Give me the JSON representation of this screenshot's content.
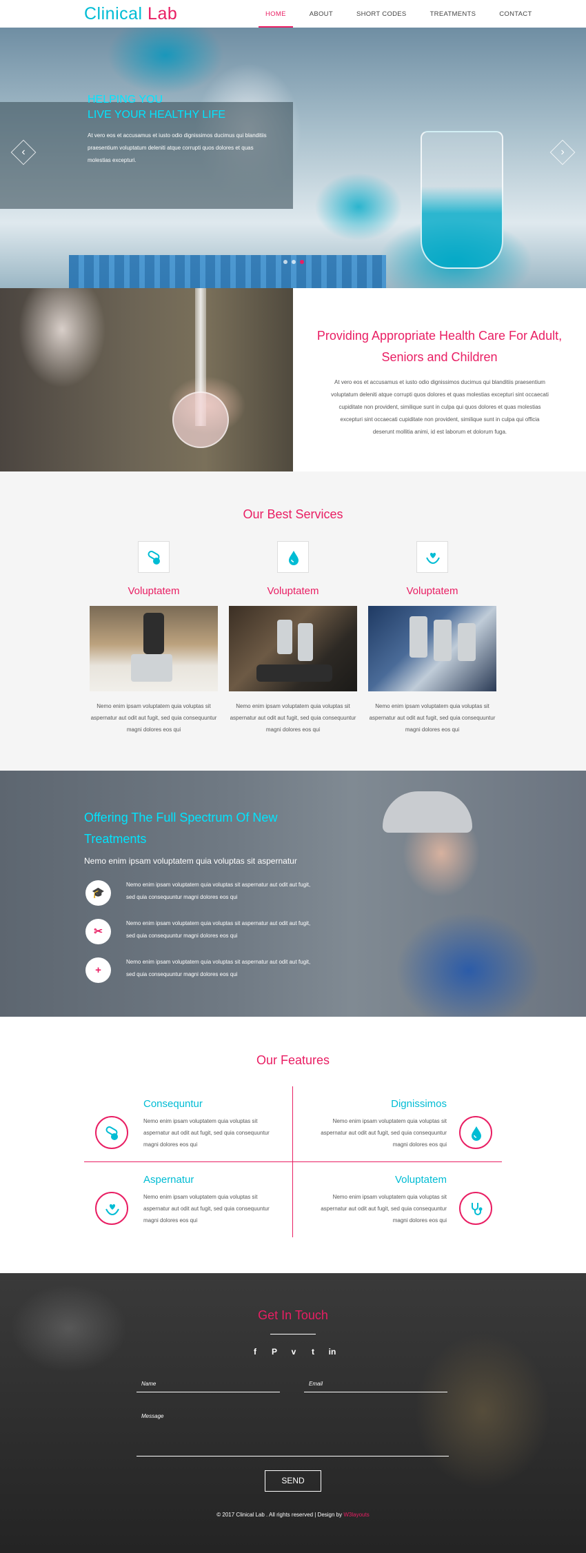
{
  "nav": {
    "logo_main": "Clinical",
    "logo_accent": "Lab",
    "items": [
      {
        "label": "HOME",
        "active": true
      },
      {
        "label": "ABOUT",
        "active": false
      },
      {
        "label": "SHORT CODES",
        "active": false
      },
      {
        "label": "TREATMENTS",
        "active": false
      },
      {
        "label": "CONTACT",
        "active": false
      }
    ]
  },
  "hero": {
    "title_line1": "HELPING YOU",
    "title_line2": "LIVE YOUR HEALTHY LIFE",
    "text": "At vero eos et accusamus et iusto odio dignissimos ducimus qui blanditiis praesentium voluptatum deleniti atque corrupti quos dolores et quas molestias excepturi.",
    "slides": 3,
    "active_slide": 3
  },
  "about": {
    "title": "Providing Appropriate Health Care For Adult, Seniors and Children",
    "text": "At vero eos et accusamus et iusto odio dignissimos ducimus qui blanditiis praesentium voluptatum deleniti atque corrupti quos dolores et quas molestias excepturi sint occaecati cupiditate non provident, similique sunt in culpa qui quos dolores et quas molestias excepturi sint occaecati cupiditate non provident, similique sunt in culpa qui officia deserunt mollitia animi, id est laborum et dolorum fuga."
  },
  "services": {
    "title": "Our Best Services",
    "items": [
      {
        "title": "Voluptatem",
        "icon": "pills-icon",
        "text": "Nemo enim ipsam voluptatem quia voluptas sit aspernatur aut odit aut fugit, sed quia consequuntur magni dolores eos qui"
      },
      {
        "title": "Voluptatem",
        "icon": "drops-icon",
        "text": "Nemo enim ipsam voluptatem quia voluptas sit aspernatur aut odit aut fugit, sed quia consequuntur magni dolores eos qui"
      },
      {
        "title": "Voluptatem",
        "icon": "heart-hands-icon",
        "text": "Nemo enim ipsam voluptatem quia voluptas sit aspernatur aut odit aut fugit, sed quia consequuntur magni dolores eos qui"
      }
    ]
  },
  "treatments": {
    "title": "Offering The Full Spectrum Of New Treatments",
    "subtitle": "Nemo enim ipsam voluptatem quia voluptas sit aspernatur",
    "items": [
      {
        "icon": "graduation-cap-icon",
        "text": "Nemo enim ipsam voluptatem quia voluptas sit aspernatur aut odit aut fugit, sed quia consequuntur magni dolores eos qui"
      },
      {
        "icon": "scissors-icon",
        "text": "Nemo enim ipsam voluptatem quia voluptas sit aspernatur aut odit aut fugit, sed quia consequuntur magni dolores eos qui"
      },
      {
        "icon": "plus-icon",
        "text": "Nemo enim ipsam voluptatem quia voluptas sit aspernatur aut odit aut fugit, sed quia consequuntur magni dolores eos qui"
      }
    ]
  },
  "features": {
    "title": "Our Features",
    "items": [
      {
        "title": "Consequntur",
        "icon": "pills-icon",
        "text": "Nemo enim ipsam voluptatem quia voluptas sit aspernatur aut odit aut fugit, sed quia consequuntur magni dolores eos qui"
      },
      {
        "title": "Dignissimos",
        "icon": "drops-icon",
        "text": "Nemo enim ipsam voluptatem quia voluptas sit aspernatur aut odit aut fugit, sed quia consequuntur magni dolores eos qui"
      },
      {
        "title": "Aspernatur",
        "icon": "heart-hands-icon",
        "text": "Nemo enim ipsam voluptatem quia voluptas sit aspernatur aut odit aut fugit, sed quia consequuntur magni dolores eos qui"
      },
      {
        "title": "Voluptatem",
        "icon": "stethoscope-icon",
        "text": "Nemo enim ipsam voluptatem quia voluptas sit aspernatur aut odit aut fugit, sed quia consequuntur magni dolores eos qui"
      }
    ]
  },
  "contact": {
    "title": "Get In Touch",
    "social": [
      {
        "icon": "facebook-icon",
        "glyph": "f"
      },
      {
        "icon": "pinterest-icon",
        "glyph": "P"
      },
      {
        "icon": "vimeo-icon",
        "glyph": "v"
      },
      {
        "icon": "twitter-icon",
        "glyph": "t"
      },
      {
        "icon": "linkedin-icon",
        "glyph": "in"
      }
    ],
    "name_label": "Name",
    "email_label": "Email",
    "message_label": "Message",
    "send_label": "SEND"
  },
  "footer": {
    "copyright": "© 2017 Clinical Lab . All rights reserved | Design by",
    "brand": "W3layouts"
  },
  "colors": {
    "accent_pink": "#e91e63",
    "accent_cyan": "#00bcd4",
    "services_bg": "#f5f5f5"
  }
}
